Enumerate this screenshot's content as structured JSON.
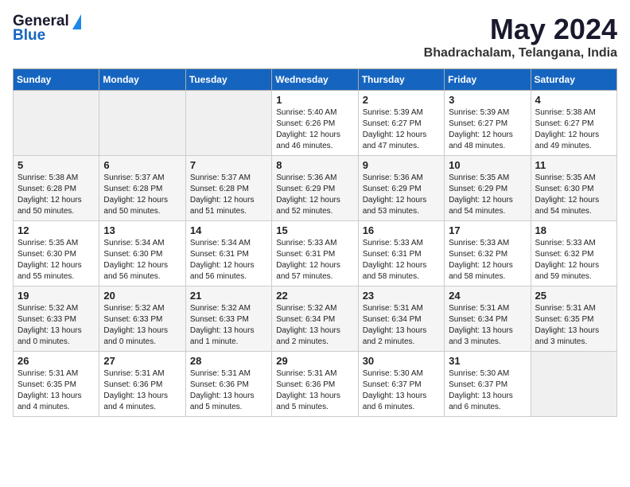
{
  "header": {
    "logo_general": "General",
    "logo_blue": "Blue",
    "title": "May 2024",
    "location": "Bhadrachalam, Telangana, India"
  },
  "days_of_week": [
    "Sunday",
    "Monday",
    "Tuesday",
    "Wednesday",
    "Thursday",
    "Friday",
    "Saturday"
  ],
  "weeks": [
    [
      {
        "day": "",
        "info": ""
      },
      {
        "day": "",
        "info": ""
      },
      {
        "day": "",
        "info": ""
      },
      {
        "day": "1",
        "info": "Sunrise: 5:40 AM\nSunset: 6:26 PM\nDaylight: 12 hours\nand 46 minutes."
      },
      {
        "day": "2",
        "info": "Sunrise: 5:39 AM\nSunset: 6:27 PM\nDaylight: 12 hours\nand 47 minutes."
      },
      {
        "day": "3",
        "info": "Sunrise: 5:39 AM\nSunset: 6:27 PM\nDaylight: 12 hours\nand 48 minutes."
      },
      {
        "day": "4",
        "info": "Sunrise: 5:38 AM\nSunset: 6:27 PM\nDaylight: 12 hours\nand 49 minutes."
      }
    ],
    [
      {
        "day": "5",
        "info": "Sunrise: 5:38 AM\nSunset: 6:28 PM\nDaylight: 12 hours\nand 50 minutes."
      },
      {
        "day": "6",
        "info": "Sunrise: 5:37 AM\nSunset: 6:28 PM\nDaylight: 12 hours\nand 50 minutes."
      },
      {
        "day": "7",
        "info": "Sunrise: 5:37 AM\nSunset: 6:28 PM\nDaylight: 12 hours\nand 51 minutes."
      },
      {
        "day": "8",
        "info": "Sunrise: 5:36 AM\nSunset: 6:29 PM\nDaylight: 12 hours\nand 52 minutes."
      },
      {
        "day": "9",
        "info": "Sunrise: 5:36 AM\nSunset: 6:29 PM\nDaylight: 12 hours\nand 53 minutes."
      },
      {
        "day": "10",
        "info": "Sunrise: 5:35 AM\nSunset: 6:29 PM\nDaylight: 12 hours\nand 54 minutes."
      },
      {
        "day": "11",
        "info": "Sunrise: 5:35 AM\nSunset: 6:30 PM\nDaylight: 12 hours\nand 54 minutes."
      }
    ],
    [
      {
        "day": "12",
        "info": "Sunrise: 5:35 AM\nSunset: 6:30 PM\nDaylight: 12 hours\nand 55 minutes."
      },
      {
        "day": "13",
        "info": "Sunrise: 5:34 AM\nSunset: 6:30 PM\nDaylight: 12 hours\nand 56 minutes."
      },
      {
        "day": "14",
        "info": "Sunrise: 5:34 AM\nSunset: 6:31 PM\nDaylight: 12 hours\nand 56 minutes."
      },
      {
        "day": "15",
        "info": "Sunrise: 5:33 AM\nSunset: 6:31 PM\nDaylight: 12 hours\nand 57 minutes."
      },
      {
        "day": "16",
        "info": "Sunrise: 5:33 AM\nSunset: 6:31 PM\nDaylight: 12 hours\nand 58 minutes."
      },
      {
        "day": "17",
        "info": "Sunrise: 5:33 AM\nSunset: 6:32 PM\nDaylight: 12 hours\nand 58 minutes."
      },
      {
        "day": "18",
        "info": "Sunrise: 5:33 AM\nSunset: 6:32 PM\nDaylight: 12 hours\nand 59 minutes."
      }
    ],
    [
      {
        "day": "19",
        "info": "Sunrise: 5:32 AM\nSunset: 6:33 PM\nDaylight: 13 hours\nand 0 minutes."
      },
      {
        "day": "20",
        "info": "Sunrise: 5:32 AM\nSunset: 6:33 PM\nDaylight: 13 hours\nand 0 minutes."
      },
      {
        "day": "21",
        "info": "Sunrise: 5:32 AM\nSunset: 6:33 PM\nDaylight: 13 hours\nand 1 minute."
      },
      {
        "day": "22",
        "info": "Sunrise: 5:32 AM\nSunset: 6:34 PM\nDaylight: 13 hours\nand 2 minutes."
      },
      {
        "day": "23",
        "info": "Sunrise: 5:31 AM\nSunset: 6:34 PM\nDaylight: 13 hours\nand 2 minutes."
      },
      {
        "day": "24",
        "info": "Sunrise: 5:31 AM\nSunset: 6:34 PM\nDaylight: 13 hours\nand 3 minutes."
      },
      {
        "day": "25",
        "info": "Sunrise: 5:31 AM\nSunset: 6:35 PM\nDaylight: 13 hours\nand 3 minutes."
      }
    ],
    [
      {
        "day": "26",
        "info": "Sunrise: 5:31 AM\nSunset: 6:35 PM\nDaylight: 13 hours\nand 4 minutes."
      },
      {
        "day": "27",
        "info": "Sunrise: 5:31 AM\nSunset: 6:36 PM\nDaylight: 13 hours\nand 4 minutes."
      },
      {
        "day": "28",
        "info": "Sunrise: 5:31 AM\nSunset: 6:36 PM\nDaylight: 13 hours\nand 5 minutes."
      },
      {
        "day": "29",
        "info": "Sunrise: 5:31 AM\nSunset: 6:36 PM\nDaylight: 13 hours\nand 5 minutes."
      },
      {
        "day": "30",
        "info": "Sunrise: 5:30 AM\nSunset: 6:37 PM\nDaylight: 13 hours\nand 6 minutes."
      },
      {
        "day": "31",
        "info": "Sunrise: 5:30 AM\nSunset: 6:37 PM\nDaylight: 13 hours\nand 6 minutes."
      },
      {
        "day": "",
        "info": ""
      }
    ]
  ]
}
